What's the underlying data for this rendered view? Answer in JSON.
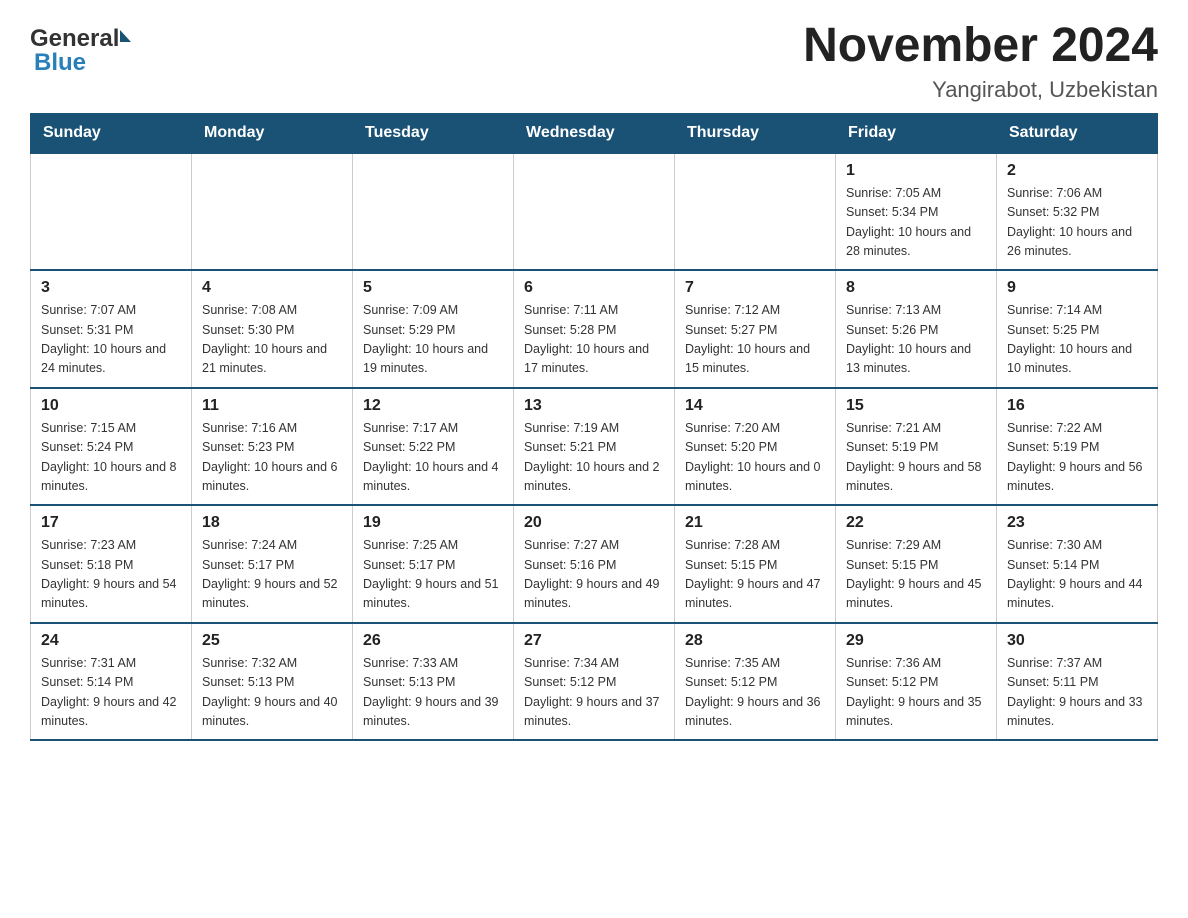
{
  "header": {
    "month_title": "November 2024",
    "location": "Yangirabot, Uzbekistan",
    "logo_general": "General",
    "logo_blue": "Blue"
  },
  "weekdays": [
    "Sunday",
    "Monday",
    "Tuesday",
    "Wednesday",
    "Thursday",
    "Friday",
    "Saturday"
  ],
  "weeks": [
    [
      {
        "day": "",
        "sunrise": "",
        "sunset": "",
        "daylight": ""
      },
      {
        "day": "",
        "sunrise": "",
        "sunset": "",
        "daylight": ""
      },
      {
        "day": "",
        "sunrise": "",
        "sunset": "",
        "daylight": ""
      },
      {
        "day": "",
        "sunrise": "",
        "sunset": "",
        "daylight": ""
      },
      {
        "day": "",
        "sunrise": "",
        "sunset": "",
        "daylight": ""
      },
      {
        "day": "1",
        "sunrise": "Sunrise: 7:05 AM",
        "sunset": "Sunset: 5:34 PM",
        "daylight": "Daylight: 10 hours and 28 minutes."
      },
      {
        "day": "2",
        "sunrise": "Sunrise: 7:06 AM",
        "sunset": "Sunset: 5:32 PM",
        "daylight": "Daylight: 10 hours and 26 minutes."
      }
    ],
    [
      {
        "day": "3",
        "sunrise": "Sunrise: 7:07 AM",
        "sunset": "Sunset: 5:31 PM",
        "daylight": "Daylight: 10 hours and 24 minutes."
      },
      {
        "day": "4",
        "sunrise": "Sunrise: 7:08 AM",
        "sunset": "Sunset: 5:30 PM",
        "daylight": "Daylight: 10 hours and 21 minutes."
      },
      {
        "day": "5",
        "sunrise": "Sunrise: 7:09 AM",
        "sunset": "Sunset: 5:29 PM",
        "daylight": "Daylight: 10 hours and 19 minutes."
      },
      {
        "day": "6",
        "sunrise": "Sunrise: 7:11 AM",
        "sunset": "Sunset: 5:28 PM",
        "daylight": "Daylight: 10 hours and 17 minutes."
      },
      {
        "day": "7",
        "sunrise": "Sunrise: 7:12 AM",
        "sunset": "Sunset: 5:27 PM",
        "daylight": "Daylight: 10 hours and 15 minutes."
      },
      {
        "day": "8",
        "sunrise": "Sunrise: 7:13 AM",
        "sunset": "Sunset: 5:26 PM",
        "daylight": "Daylight: 10 hours and 13 minutes."
      },
      {
        "day": "9",
        "sunrise": "Sunrise: 7:14 AM",
        "sunset": "Sunset: 5:25 PM",
        "daylight": "Daylight: 10 hours and 10 minutes."
      }
    ],
    [
      {
        "day": "10",
        "sunrise": "Sunrise: 7:15 AM",
        "sunset": "Sunset: 5:24 PM",
        "daylight": "Daylight: 10 hours and 8 minutes."
      },
      {
        "day": "11",
        "sunrise": "Sunrise: 7:16 AM",
        "sunset": "Sunset: 5:23 PM",
        "daylight": "Daylight: 10 hours and 6 minutes."
      },
      {
        "day": "12",
        "sunrise": "Sunrise: 7:17 AM",
        "sunset": "Sunset: 5:22 PM",
        "daylight": "Daylight: 10 hours and 4 minutes."
      },
      {
        "day": "13",
        "sunrise": "Sunrise: 7:19 AM",
        "sunset": "Sunset: 5:21 PM",
        "daylight": "Daylight: 10 hours and 2 minutes."
      },
      {
        "day": "14",
        "sunrise": "Sunrise: 7:20 AM",
        "sunset": "Sunset: 5:20 PM",
        "daylight": "Daylight: 10 hours and 0 minutes."
      },
      {
        "day": "15",
        "sunrise": "Sunrise: 7:21 AM",
        "sunset": "Sunset: 5:19 PM",
        "daylight": "Daylight: 9 hours and 58 minutes."
      },
      {
        "day": "16",
        "sunrise": "Sunrise: 7:22 AM",
        "sunset": "Sunset: 5:19 PM",
        "daylight": "Daylight: 9 hours and 56 minutes."
      }
    ],
    [
      {
        "day": "17",
        "sunrise": "Sunrise: 7:23 AM",
        "sunset": "Sunset: 5:18 PM",
        "daylight": "Daylight: 9 hours and 54 minutes."
      },
      {
        "day": "18",
        "sunrise": "Sunrise: 7:24 AM",
        "sunset": "Sunset: 5:17 PM",
        "daylight": "Daylight: 9 hours and 52 minutes."
      },
      {
        "day": "19",
        "sunrise": "Sunrise: 7:25 AM",
        "sunset": "Sunset: 5:17 PM",
        "daylight": "Daylight: 9 hours and 51 minutes."
      },
      {
        "day": "20",
        "sunrise": "Sunrise: 7:27 AM",
        "sunset": "Sunset: 5:16 PM",
        "daylight": "Daylight: 9 hours and 49 minutes."
      },
      {
        "day": "21",
        "sunrise": "Sunrise: 7:28 AM",
        "sunset": "Sunset: 5:15 PM",
        "daylight": "Daylight: 9 hours and 47 minutes."
      },
      {
        "day": "22",
        "sunrise": "Sunrise: 7:29 AM",
        "sunset": "Sunset: 5:15 PM",
        "daylight": "Daylight: 9 hours and 45 minutes."
      },
      {
        "day": "23",
        "sunrise": "Sunrise: 7:30 AM",
        "sunset": "Sunset: 5:14 PM",
        "daylight": "Daylight: 9 hours and 44 minutes."
      }
    ],
    [
      {
        "day": "24",
        "sunrise": "Sunrise: 7:31 AM",
        "sunset": "Sunset: 5:14 PM",
        "daylight": "Daylight: 9 hours and 42 minutes."
      },
      {
        "day": "25",
        "sunrise": "Sunrise: 7:32 AM",
        "sunset": "Sunset: 5:13 PM",
        "daylight": "Daylight: 9 hours and 40 minutes."
      },
      {
        "day": "26",
        "sunrise": "Sunrise: 7:33 AM",
        "sunset": "Sunset: 5:13 PM",
        "daylight": "Daylight: 9 hours and 39 minutes."
      },
      {
        "day": "27",
        "sunrise": "Sunrise: 7:34 AM",
        "sunset": "Sunset: 5:12 PM",
        "daylight": "Daylight: 9 hours and 37 minutes."
      },
      {
        "day": "28",
        "sunrise": "Sunrise: 7:35 AM",
        "sunset": "Sunset: 5:12 PM",
        "daylight": "Daylight: 9 hours and 36 minutes."
      },
      {
        "day": "29",
        "sunrise": "Sunrise: 7:36 AM",
        "sunset": "Sunset: 5:12 PM",
        "daylight": "Daylight: 9 hours and 35 minutes."
      },
      {
        "day": "30",
        "sunrise": "Sunrise: 7:37 AM",
        "sunset": "Sunset: 5:11 PM",
        "daylight": "Daylight: 9 hours and 33 minutes."
      }
    ]
  ]
}
